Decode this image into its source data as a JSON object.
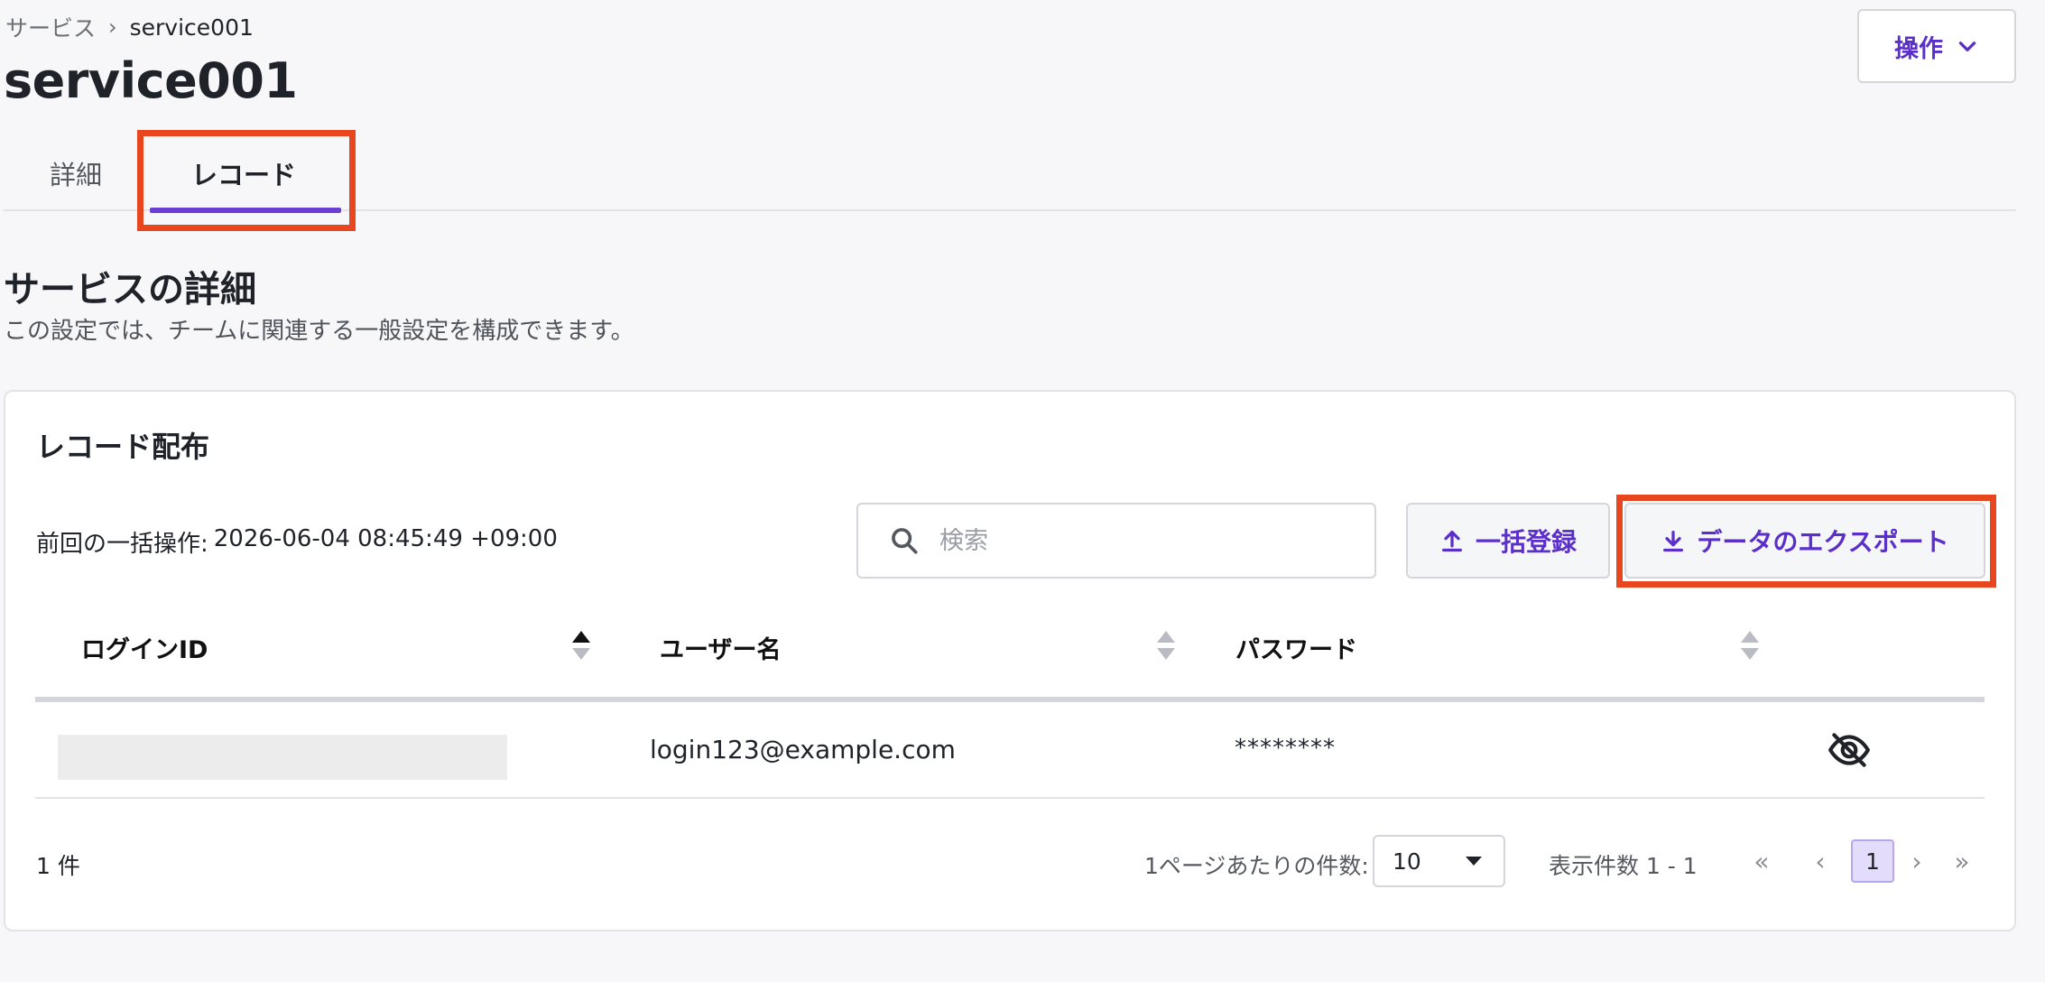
{
  "breadcrumb": {
    "root": "サービス",
    "separator": "›",
    "current": "service001"
  },
  "page": {
    "title": "service001"
  },
  "header": {
    "action_label": "操作"
  },
  "tabs": [
    {
      "label": "詳細",
      "active": false
    },
    {
      "label": "レコード",
      "active": true
    }
  ],
  "section": {
    "title": "サービスの詳細",
    "description": "この設定では、チームに関連する一般設定を構成できます。"
  },
  "card": {
    "title": "レコード配布",
    "last_operation_label": "前回の一括操作:",
    "last_operation_time": "2026-06-04 08:45:49 +09:00",
    "search_placeholder": "検索",
    "bulk_register_label": "一括登録",
    "export_label": "データのエクスポート"
  },
  "table": {
    "columns": [
      "ログインID",
      "ユーザー名",
      "パスワード"
    ],
    "rows": [
      {
        "login_id": "",
        "username": "login123@example.com",
        "password": "********"
      }
    ]
  },
  "pagination": {
    "total": "1 件",
    "per_page_label": "1ページあたりの件数:",
    "per_page_value": "10",
    "range": "表示件数 1 - 1",
    "current_page": "1",
    "first": "«",
    "prev": "‹",
    "next": "›",
    "last": "»"
  },
  "colors": {
    "accent": "#5b2fc9",
    "tab_underline": "#6b3fd4",
    "highlight": "#e8461f",
    "active_page_bg": "#e3dcfb"
  }
}
